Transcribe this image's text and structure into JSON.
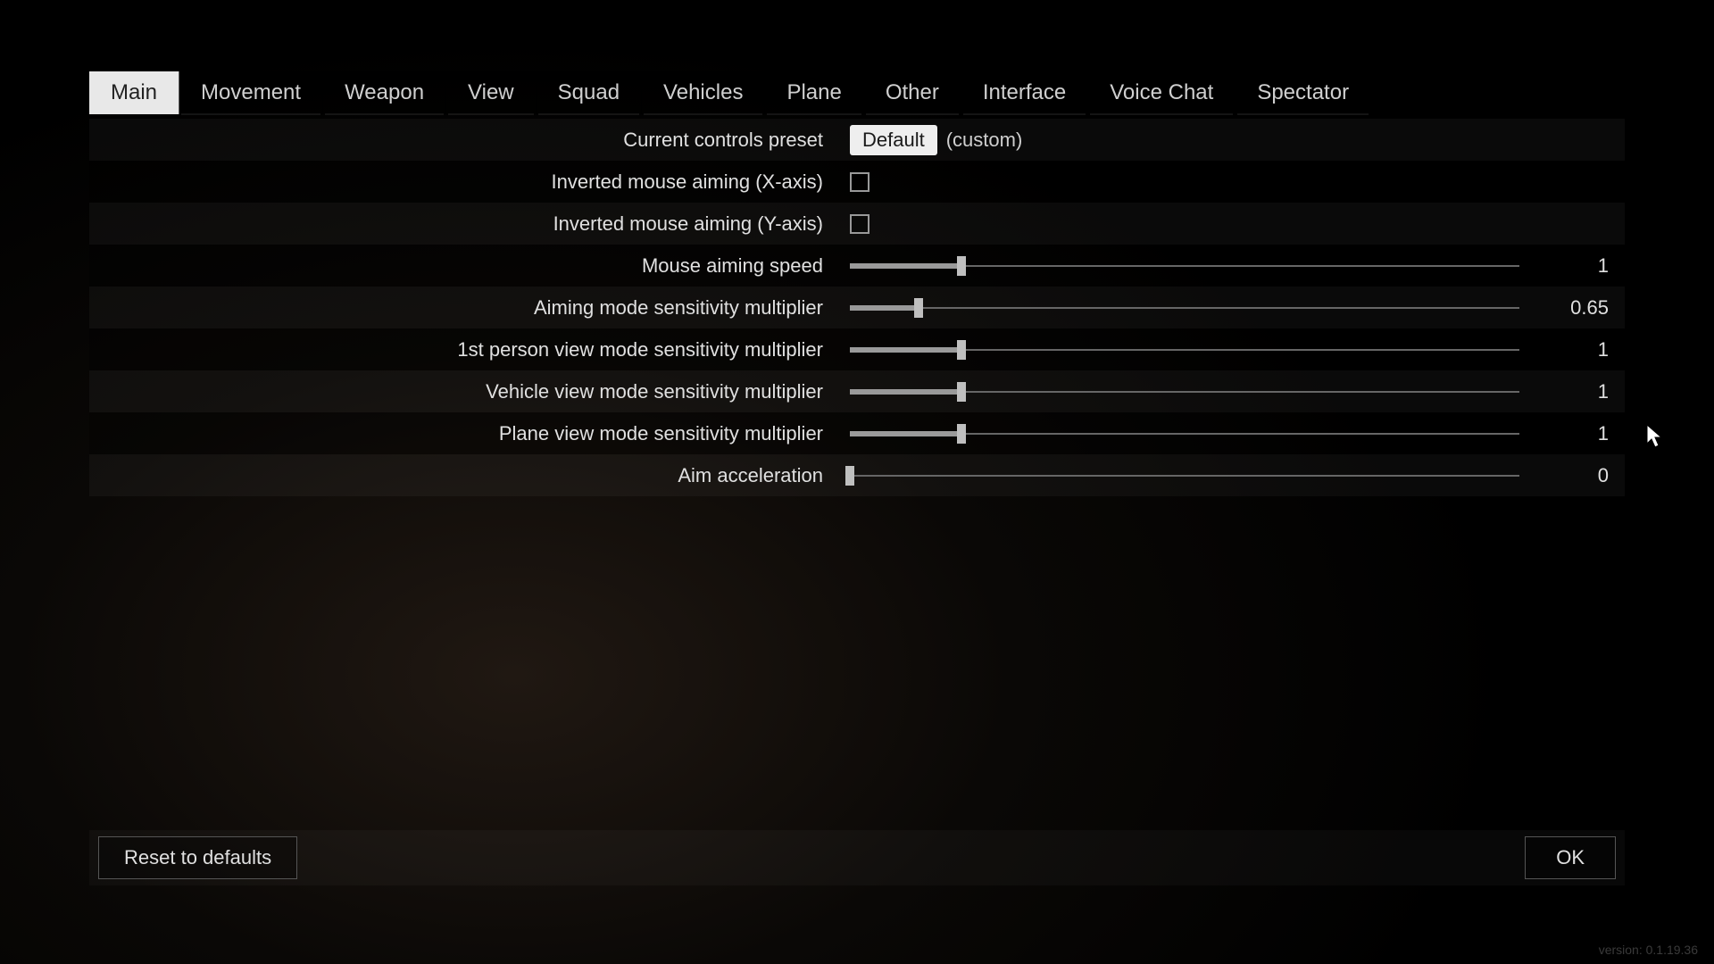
{
  "tabs": [
    {
      "label": "Main",
      "active": true
    },
    {
      "label": "Movement",
      "active": false
    },
    {
      "label": "Weapon",
      "active": false
    },
    {
      "label": "View",
      "active": false
    },
    {
      "label": "Squad",
      "active": false
    },
    {
      "label": "Vehicles",
      "active": false
    },
    {
      "label": "Plane",
      "active": false
    },
    {
      "label": "Other",
      "active": false
    },
    {
      "label": "Interface",
      "active": false
    },
    {
      "label": "Voice Chat",
      "active": false
    },
    {
      "label": "Spectator",
      "active": false
    }
  ],
  "preset": {
    "label": "Current controls preset",
    "value": "Default",
    "suffix": "(custom)"
  },
  "settings": [
    {
      "kind": "checkbox",
      "label": "Inverted mouse aiming (X-axis)",
      "checked": false
    },
    {
      "kind": "checkbox",
      "label": "Inverted mouse aiming (Y-axis)",
      "checked": false
    },
    {
      "kind": "slider",
      "label": "Mouse aiming speed",
      "value": 1,
      "display": "1",
      "min": 0,
      "max": 6,
      "fill_pct": 16.7
    },
    {
      "kind": "slider",
      "label": "Aiming mode sensitivity multiplier",
      "value": 0.65,
      "display": "0.65",
      "min": 0,
      "max": 6,
      "fill_pct": 10.2
    },
    {
      "kind": "slider",
      "label": "1st person view mode sensitivity multiplier",
      "value": 1,
      "display": "1",
      "min": 0,
      "max": 6,
      "fill_pct": 16.7
    },
    {
      "kind": "slider",
      "label": "Vehicle view mode sensitivity multiplier",
      "value": 1,
      "display": "1",
      "min": 0,
      "max": 6,
      "fill_pct": 16.7
    },
    {
      "kind": "slider",
      "label": "Plane view mode sensitivity multiplier",
      "value": 1,
      "display": "1",
      "min": 0,
      "max": 6,
      "fill_pct": 16.7
    },
    {
      "kind": "slider",
      "label": "Aim acceleration",
      "value": 0,
      "display": "0",
      "min": 0,
      "max": 6,
      "fill_pct": 0
    }
  ],
  "footer": {
    "reset_label": "Reset to defaults",
    "ok_label": "OK"
  },
  "version_label": "version: 0.1.19.36"
}
